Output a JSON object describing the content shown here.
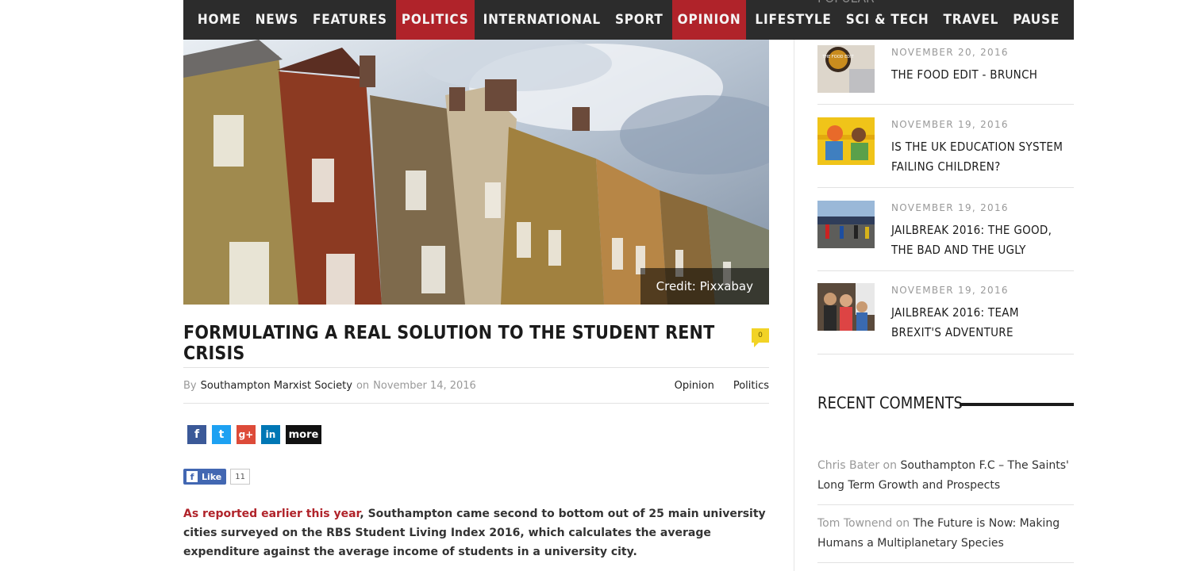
{
  "nav": {
    "items": [
      {
        "label": "HOME",
        "active": false
      },
      {
        "label": "NEWS",
        "active": false
      },
      {
        "label": "FEATURES",
        "active": false
      },
      {
        "label": "POLITICS",
        "active": true
      },
      {
        "label": "INTERNATIONAL",
        "active": false
      },
      {
        "label": "SPORT",
        "active": false
      },
      {
        "label": "OPINION",
        "active": true
      },
      {
        "label": "LIFESTYLE",
        "active": false
      },
      {
        "label": "SCI & TECH",
        "active": false
      },
      {
        "label": "TRAVEL",
        "active": false
      },
      {
        "label": "PAUSE",
        "active": false
      }
    ],
    "active_color": "#b0232a"
  },
  "hero": {
    "credit": "Credit: Pixxabay"
  },
  "article": {
    "title": "FORMULATING A REAL SOLUTION TO THE STUDENT RENT CRISIS",
    "comment_count": "0",
    "by_label": "By",
    "author": "Southampton Marxist Society",
    "on_label": "on",
    "date": "November 14, 2016",
    "categories": [
      "Opinion",
      "Politics"
    ],
    "share": {
      "facebook": "f",
      "twitter": "t",
      "googleplus": "g+",
      "linkedin": "in",
      "more": "more"
    },
    "fb_like": {
      "label": "Like",
      "count": "11"
    },
    "body": {
      "link_text": "As reported earlier this year",
      "text": ", Southampton came second to bottom out of 25 main university cities surveyed on the RBS Student Living Index 2016, which calculates the average expenditure against the average income of students in a university city."
    }
  },
  "sidebar": {
    "popular_heading": "POPULAR",
    "popular": [
      {
        "date": "NOVEMBER 20, 2016",
        "title": "THE FOOD EDIT - BRUNCH"
      },
      {
        "date": "NOVEMBER 19, 2016",
        "title": "IS THE UK EDUCATION SYSTEM FAILING CHILDREN?"
      },
      {
        "date": "NOVEMBER 19, 2016",
        "title": "JAILBREAK 2016: THE GOOD, THE BAD AND THE UGLY"
      },
      {
        "date": "NOVEMBER 19, 2016",
        "title": "JAILBREAK 2016: TEAM BREXIT'S ADVENTURE"
      }
    ],
    "thumb_texts": {
      "food_edit": "THE FOOD EDIT"
    },
    "recent_comments_heading": "RECENT COMMENTS",
    "recent_comments": [
      {
        "author": "Chris Bater",
        "on": "on",
        "post": "Southampton F.C – The Saints' Long Term Growth and Prospects"
      },
      {
        "author": "Tom Townend",
        "on": "on",
        "post": "The Future is Now: Making Humans a Multiplanetary Species"
      }
    ]
  },
  "colors": {
    "facebook": "#3b5998",
    "twitter": "#1da1f2",
    "googleplus": "#dd4b39",
    "linkedin": "#0077b5",
    "brand_red": "#b0232a",
    "badge_yellow": "#f2d326"
  }
}
